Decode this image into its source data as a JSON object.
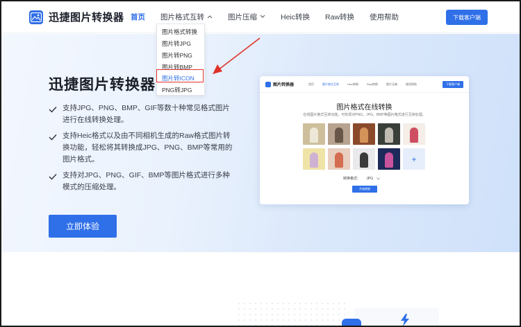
{
  "header": {
    "logo_text": "迅捷图片转换器",
    "nav": [
      {
        "label": "首页",
        "active": true,
        "chevron": false
      },
      {
        "label": "图片格式互转",
        "active": false,
        "chevron": true
      },
      {
        "label": "图片压缩",
        "active": false,
        "chevron": true
      },
      {
        "label": "Heic转换",
        "active": false,
        "chevron": false
      },
      {
        "label": "Raw转换",
        "active": false,
        "chevron": false
      },
      {
        "label": "使用帮助",
        "active": false,
        "chevron": false
      }
    ],
    "download_label": "下载客户端"
  },
  "dropdown": {
    "items": [
      "图片格式转换",
      "图片转JPG",
      "图片转PNG",
      "图片转BMP",
      "图片转ICON",
      "PNG转JPG"
    ],
    "highlighted_index": 4
  },
  "hero": {
    "title": "迅捷图片转换器",
    "features": [
      "支持JPG、PNG、BMP、GIF等数十种常见格式图片进行在线转换处理。",
      "支持Heic格式以及由不同相机生成的Raw格式图片转换功能，轻松将其转换成JPG、PNG、BMP等常用的图片格式。",
      "支持对JPG、PNG、GIF、BMP等图片格式进行多种模式的压缩处理。"
    ],
    "cta_label": "立即体验"
  },
  "preview": {
    "logo_text": "图片转换器",
    "nav": [
      "首页",
      "图片格式互转",
      "Heic转换",
      "Raw转换",
      "图片压缩",
      "使用帮助"
    ],
    "download_label": "下载客户端",
    "title": "图片格式在线转换",
    "subtitle": "在线图片格式互转功能，可实现对PNG、JPG、BMP等图片格式进行互转处理。",
    "format_label": "转换格式:",
    "format_value": "JPG",
    "start_label": "开始转换",
    "add_icon": "+"
  },
  "colors": {
    "accent": "#2f6fe8",
    "highlight_box": "#e0322b",
    "arrow": "#e0322b"
  }
}
